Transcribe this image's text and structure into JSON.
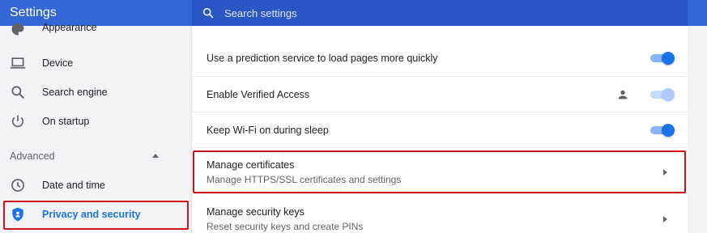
{
  "header": {
    "app_title": "Settings",
    "search_placeholder": "Search settings"
  },
  "sidebar": {
    "items": [
      {
        "label": "Appearance",
        "icon": "palette-icon"
      },
      {
        "label": "Device",
        "icon": "laptop-icon"
      },
      {
        "label": "Search engine",
        "icon": "search-icon"
      },
      {
        "label": "On startup",
        "icon": "power-icon"
      }
    ],
    "section_label": "Advanced",
    "advanced_items": [
      {
        "label": "Date and time",
        "icon": "clock-icon"
      },
      {
        "label": "Privacy and security",
        "icon": "shield-icon",
        "active": true
      }
    ]
  },
  "main": {
    "rows": [
      {
        "title": "Use a prediction service to load pages more quickly",
        "control": "toggle",
        "state": "on"
      },
      {
        "title": "Enable Verified Access",
        "control": "toggle",
        "state": "on-disabled",
        "icon": "person-icon"
      },
      {
        "title": "Keep Wi-Fi on during sleep",
        "control": "toggle",
        "state": "on"
      },
      {
        "title": "Manage certificates",
        "subtitle": "Manage HTTPS/SSL certificates and settings",
        "control": "chevron"
      },
      {
        "title": "Manage security keys",
        "subtitle": "Reset security keys and create PINs",
        "control": "chevron"
      }
    ]
  },
  "colors": {
    "header_bg": "#3367d6",
    "accent": "#1a73e8",
    "highlight": "#d0101b"
  }
}
